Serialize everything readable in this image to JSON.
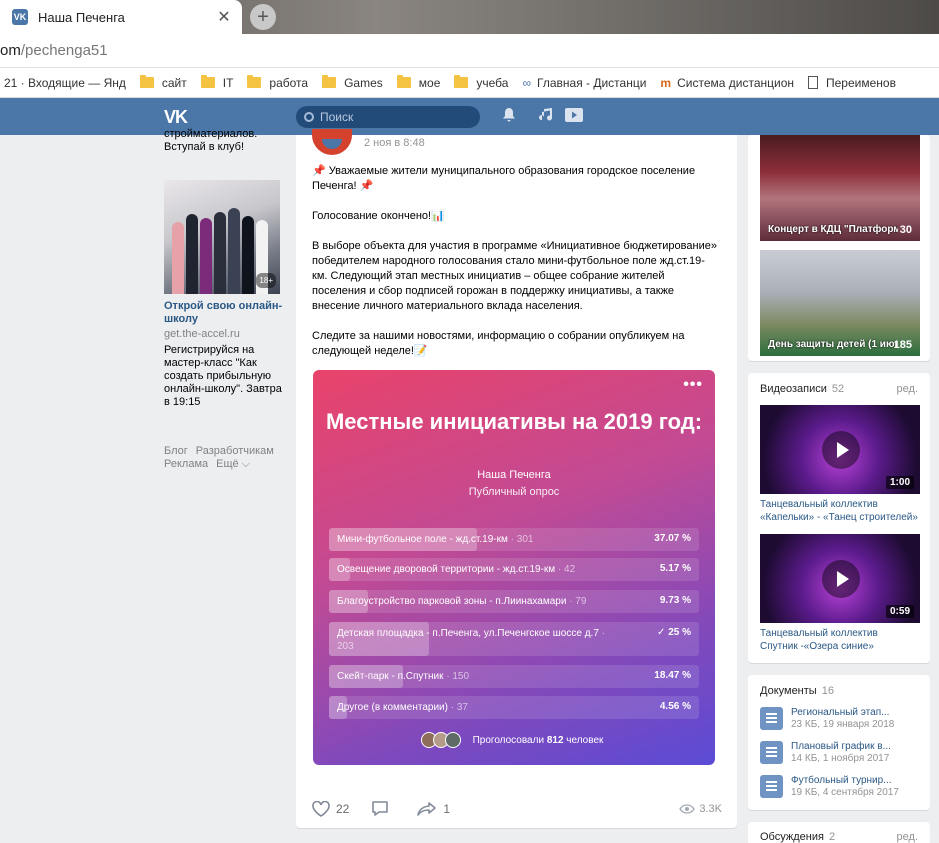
{
  "browser": {
    "tab_title": "Наша Печенга",
    "tab_favicon": "VK",
    "close_glyph": "✕",
    "newtab_glyph": "+",
    "url_host": "om",
    "url_path": "/pechenga51",
    "bookmarks": [
      {
        "label": "21 · Входящие — Янд",
        "icon": "none"
      },
      {
        "label": "сайт",
        "icon": "folder-icon"
      },
      {
        "label": "IT",
        "icon": "folder-icon"
      },
      {
        "label": "работа",
        "icon": "folder-icon"
      },
      {
        "label": "Games",
        "icon": "folder-icon"
      },
      {
        "label": "мое",
        "icon": "folder-icon"
      },
      {
        "label": "учеба",
        "icon": "folder-icon"
      },
      {
        "label": "Главная - Дистанци",
        "icon": "moodle-icon"
      },
      {
        "label": "Система дистанцион",
        "icon": "moodle-icon"
      },
      {
        "label": "Переименов",
        "icon": "page-icon"
      }
    ]
  },
  "vk": {
    "logo": "VK",
    "search_placeholder": "Поиск"
  },
  "leftcol": {
    "top_text": "стройматериалов. Вступай в клуб!",
    "ad": {
      "age_badge": "18+",
      "title": "Открой свою онлайн-школу",
      "domain": "get.the-accel.ru",
      "text": "Регистрируйся на мастер-класс \"Как создать прибыльную онлайн-школу\". Завтра в 19:15"
    },
    "footer": [
      "Блог",
      "Разработчикам",
      "Реклама",
      "Ещё ⌵"
    ]
  },
  "post": {
    "date": "2 ноя в 8:48",
    "paragraphs": [
      "📌 Уважаемые жители муниципального образования городское поселение Печенга! 📌",
      "Голосование окончено!📊",
      "В выборе объекта для участия в программе «Инициативное бюджетирование» победителем народного голосования стало мини-футбольное поле жд.ст.19-км. Следующий этап местных инициатив – общее собрание жителей поселения и сбор подписей горожан в поддержку инициативы, а также внесение личного материального вклада населения.",
      "Следите за нашими новостями, информацию о собрании опубликуем на следующей неделе!📝"
    ],
    "poll": {
      "more": "•••",
      "title": "Местные инициативы на 2019 год:",
      "author": "Наша Печенга",
      "kind": "Публичный опрос",
      "options": [
        {
          "label": "Мини-футбольное поле - жд.ст.19-км",
          "votes": " · 301",
          "percent": "37.07 %",
          "share": 0.3707,
          "checked": false
        },
        {
          "label": "Освещение дворовой территории - жд.ст.19-км",
          "votes": " · 42",
          "percent": "5.17 %",
          "share": 0.0517,
          "checked": false
        },
        {
          "label": "Благоустройство парковой зоны - п.Лиинахамари",
          "votes": " · 79",
          "percent": "9.73 %",
          "share": 0.0973,
          "checked": false
        },
        {
          "label": "Детская площадка - п.Печенга, ул.Печенгское шоссе д.7",
          "votes": " · 203",
          "percent": "25 %",
          "share": 0.25,
          "checked": true
        },
        {
          "label": "Скейт-парк - п.Спутник",
          "votes": " · 150",
          "percent": "18.47 %",
          "share": 0.1847,
          "checked": false
        },
        {
          "label": "Другое (в комментарии)",
          "votes": " · 37",
          "percent": "4.56 %",
          "share": 0.0456,
          "checked": false
        }
      ],
      "voted_prefix": "Проголосовали ",
      "voted_count": "812",
      "voted_suffix": " человек"
    },
    "likes": "22",
    "shares": "1",
    "views": "3.3K"
  },
  "rightcol": {
    "photos": [
      {
        "caption": "Концерт в КДЦ \"Платформа\"",
        "count": "30"
      },
      {
        "caption": "День защиты детей (1 июня)",
        "count": "185"
      }
    ],
    "videos_header": {
      "name": "Видеозаписи",
      "count": "52",
      "edit": "ред."
    },
    "videos": [
      {
        "duration": "1:00",
        "title": "Танцевальный коллектив «Капельки» - «Танец строителей»"
      },
      {
        "duration": "0:59",
        "title": "Танцевальный коллектив Спутник -«Озера синие»"
      }
    ],
    "docs_header": {
      "name": "Документы",
      "count": "16"
    },
    "docs": [
      {
        "name": "Региональный этап...",
        "meta": "23 КБ, 19 января 2018"
      },
      {
        "name": "Плановый график в...",
        "meta": "14 КБ, 1 ноября 2017"
      },
      {
        "name": "Футбольный турнир...",
        "meta": "19 КБ, 4 сентября 2017"
      }
    ],
    "discuss_header": {
      "name": "Обсуждения",
      "count": "2",
      "edit": "ред."
    }
  },
  "colors": {
    "vk_blue": "#4a76a8",
    "link": "#2a5885"
  }
}
